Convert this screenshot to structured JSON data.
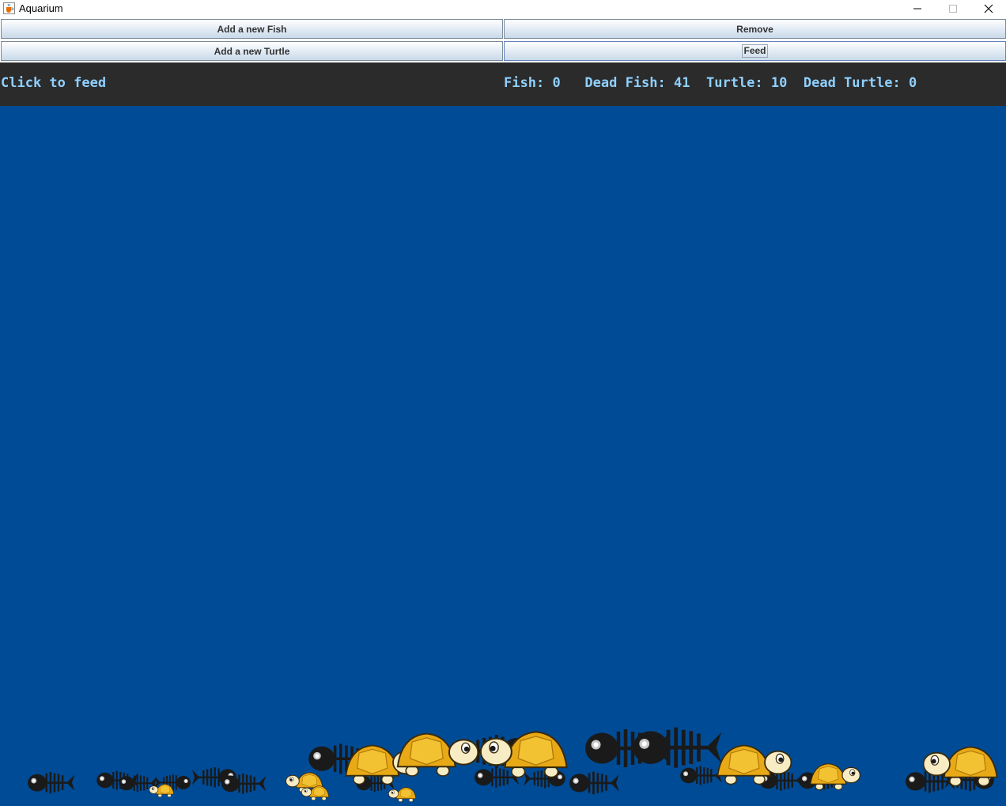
{
  "window": {
    "title": "Aquarium",
    "icon": "java-cup-icon"
  },
  "toolbar": {
    "add_fish_label": "Add a new Fish",
    "remove_label": "Remove",
    "add_turtle_label": "Add a new Turtle",
    "feed_label": "Feed"
  },
  "status": {
    "hint": "Click to feed",
    "fish_label": "Fish:",
    "fish_count": "0",
    "dead_fish_label": "Dead Fish:",
    "dead_fish_count": "41",
    "turtle_label": "Turtle:",
    "turtle_count": "10",
    "dead_turtle_label": "Dead Turtle:",
    "dead_turtle_count": "0"
  },
  "colors": {
    "tank_water": "#004b96",
    "status_background": "#2b2b2b",
    "status_text": "#8fd0ff",
    "turtle_shell": "#e8a916",
    "turtle_skin": "#f7ecc4",
    "skeleton": "#1a1a1a"
  },
  "tank": {
    "dead_fish_icon": "fish-skeleton-icon",
    "turtle_icon": "turtle-icon"
  }
}
